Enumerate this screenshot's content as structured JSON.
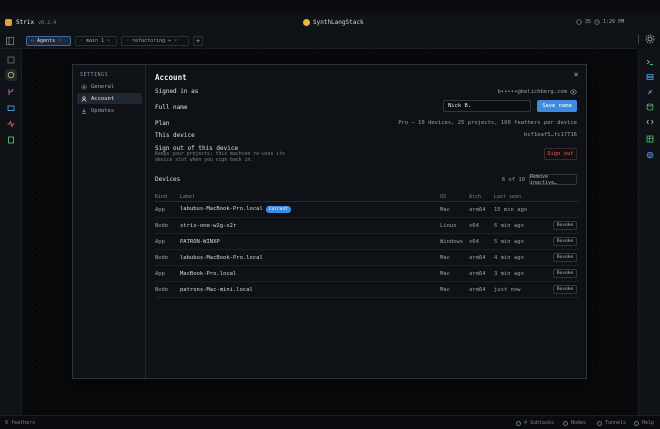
{
  "app": {
    "name": "Strix",
    "version": "v0.2.4",
    "project": "SynthLangStack",
    "zoom": "35",
    "clock": "1:29 PM"
  },
  "tabs": [
    {
      "label": "Agents"
    },
    {
      "label": "main 1"
    },
    {
      "label": "refactoring +"
    }
  ],
  "settings": {
    "heading": "SETTINGS",
    "nav": [
      {
        "label": "General"
      },
      {
        "label": "Account"
      },
      {
        "label": "Updates"
      }
    ]
  },
  "account": {
    "title": "Account",
    "signed_in_label": "Signed in as",
    "email": "b•••••@belichberg.com",
    "full_name_label": "Full name",
    "full_name_value": "Nick B.",
    "save_label": "Save name",
    "plan_label": "Plan",
    "plan_value": "Pro — 10 devices, 25 projects, 100 feathers per device",
    "device_label": "This device",
    "device_id": "bcf1eaf5…fc17716",
    "signout_title": "Sign out of this device",
    "signout_desc": "Keeps your projects; this machine re-uses its device slot when you sign back in.",
    "signout_button": "Sign out"
  },
  "devices": {
    "title": "Devices",
    "count": "6 of 10",
    "remove_inactive": "Remove inactive…",
    "columns": [
      "Kind",
      "Label",
      "OS",
      "Arch",
      "Last seen"
    ],
    "current_badge": "Current",
    "revoke_label": "Revoke",
    "rows": [
      {
        "kind": "App",
        "label": "labubus-MacBook-Pro.local",
        "os": "Mac",
        "arch": "arm64",
        "last_seen": "15 min ago",
        "current": true
      },
      {
        "kind": "Node",
        "label": "strix-one-w2g-x2r",
        "os": "Linux",
        "arch": "x64",
        "last_seen": "6 min ago",
        "current": false
      },
      {
        "kind": "App",
        "label": "PATRON-WINXP",
        "os": "Windows",
        "arch": "x64",
        "last_seen": "5 min ago",
        "current": false
      },
      {
        "kind": "Node",
        "label": "labubus-MacBook-Pro.local",
        "os": "Mac",
        "arch": "arm64",
        "last_seen": "4 min ago",
        "current": false
      },
      {
        "kind": "App",
        "label": "MacBook-Pro.local",
        "os": "Mac",
        "arch": "arm64",
        "last_seen": "3 min ago",
        "current": false
      },
      {
        "kind": "Node",
        "label": "patrons-Mac-mini.local",
        "os": "Mac",
        "arch": "arm64",
        "last_seen": "just now",
        "current": false
      }
    ]
  },
  "status": {
    "left": "0 feathers",
    "items": [
      "4 Subtasks",
      "Nodes",
      "Tunnels",
      "Help"
    ]
  },
  "colors": {
    "accent": "#3c8be0",
    "danger": "#e05f5f",
    "background": "#0d1014"
  }
}
